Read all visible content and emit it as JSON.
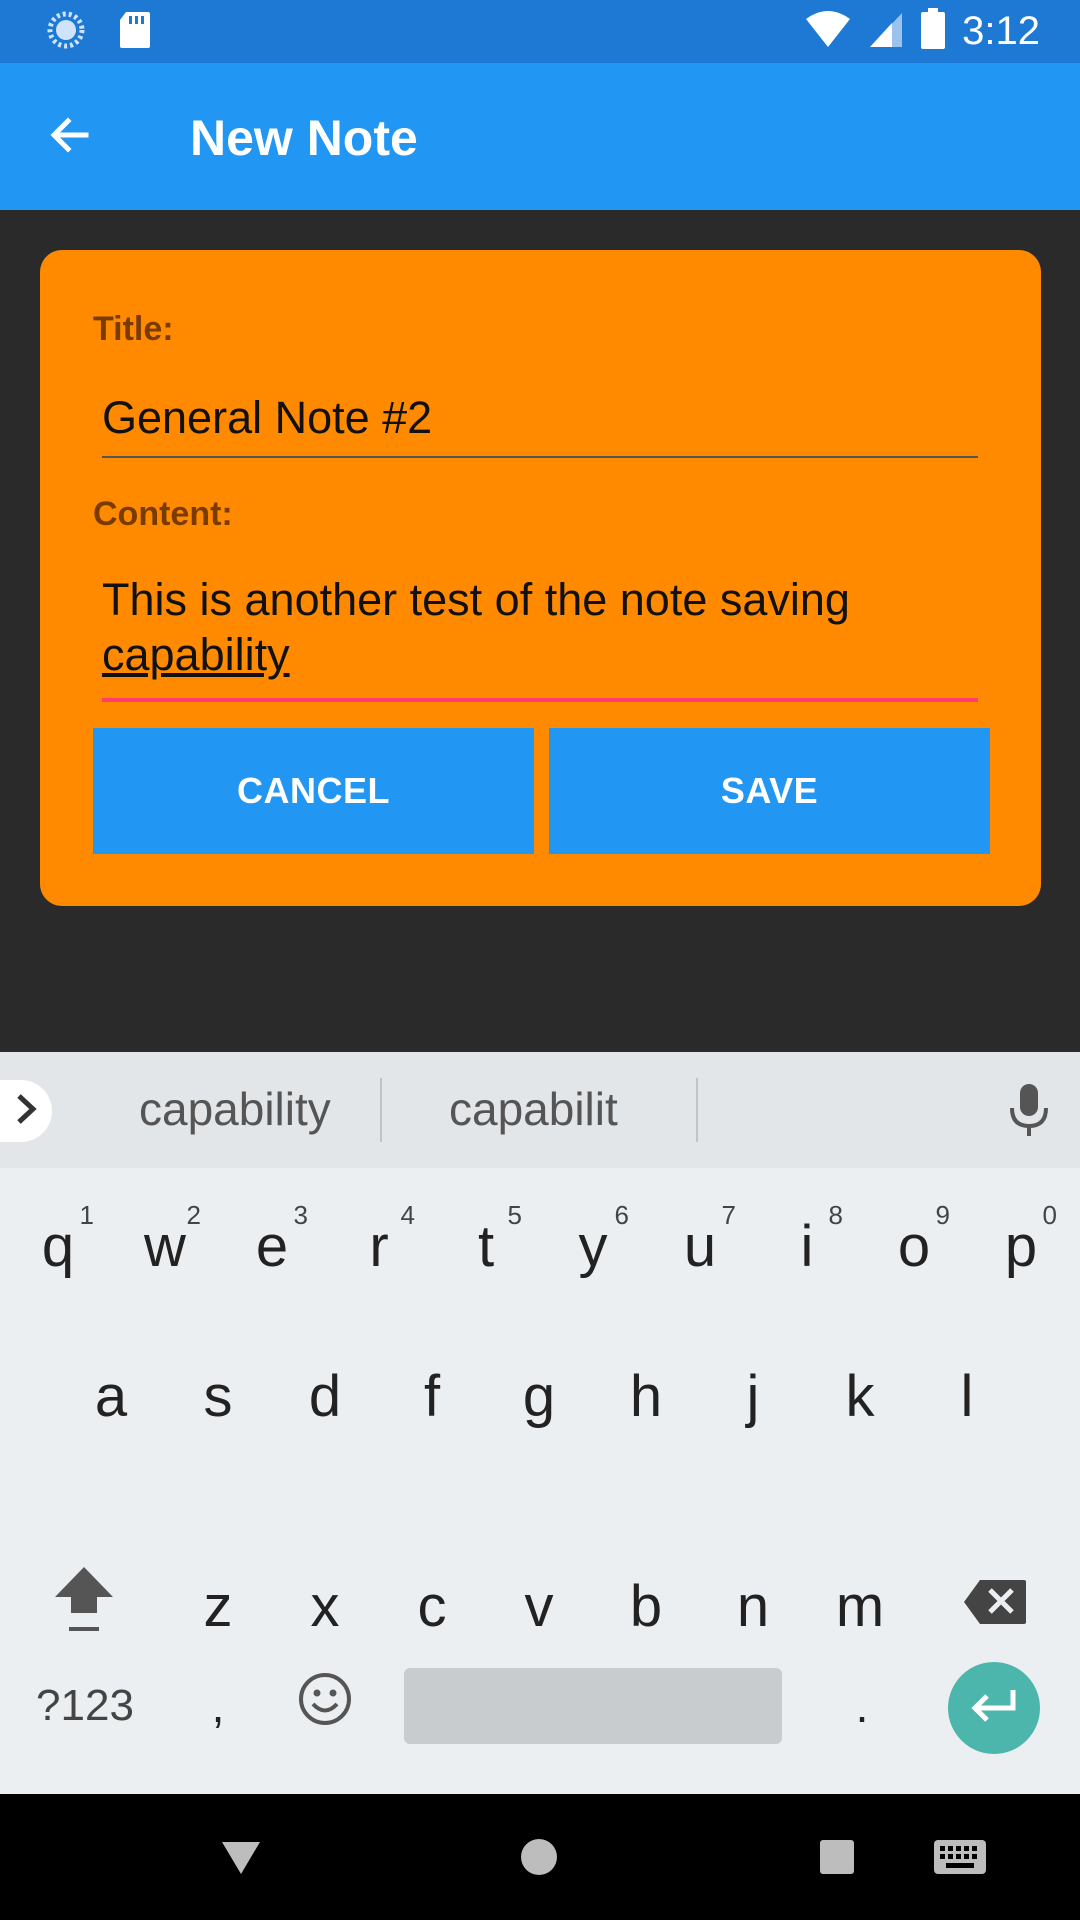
{
  "status_bar": {
    "time": "3:12",
    "icons": [
      "sync-icon",
      "sd-card-icon",
      "wifi-icon",
      "signal-icon",
      "battery-icon"
    ]
  },
  "app_bar": {
    "title": "New Note",
    "back_icon": "arrow-left-icon",
    "color": "#2196f3"
  },
  "form": {
    "title_label": "Title:",
    "title_value": "General Note #2",
    "content_label": "Content:",
    "content_value": "This is another test of the note saving",
    "content_composing": "capability",
    "card_color": "#ff8a00",
    "cancel_label": "CANCEL",
    "save_label": "SAVE"
  },
  "keyboard": {
    "suggestions": [
      "capability",
      "capabilit"
    ],
    "row1": [
      {
        "key": "q",
        "hint": "1"
      },
      {
        "key": "w",
        "hint": "2"
      },
      {
        "key": "e",
        "hint": "3"
      },
      {
        "key": "r",
        "hint": "4"
      },
      {
        "key": "t",
        "hint": "5"
      },
      {
        "key": "y",
        "hint": "6"
      },
      {
        "key": "u",
        "hint": "7"
      },
      {
        "key": "i",
        "hint": "8"
      },
      {
        "key": "o",
        "hint": "9"
      },
      {
        "key": "p",
        "hint": "0"
      }
    ],
    "row2": [
      "a",
      "s",
      "d",
      "f",
      "g",
      "h",
      "j",
      "k",
      "l"
    ],
    "row3": [
      "z",
      "x",
      "c",
      "v",
      "b",
      "n",
      "m"
    ],
    "symbols_label": "?123",
    "comma_label": ",",
    "period_label": ".",
    "enter_color": "#4db6ac"
  },
  "nav_bar": {
    "icons": [
      "back-triangle-icon",
      "home-circle-icon",
      "recents-square-icon",
      "keyboard-icon"
    ]
  }
}
